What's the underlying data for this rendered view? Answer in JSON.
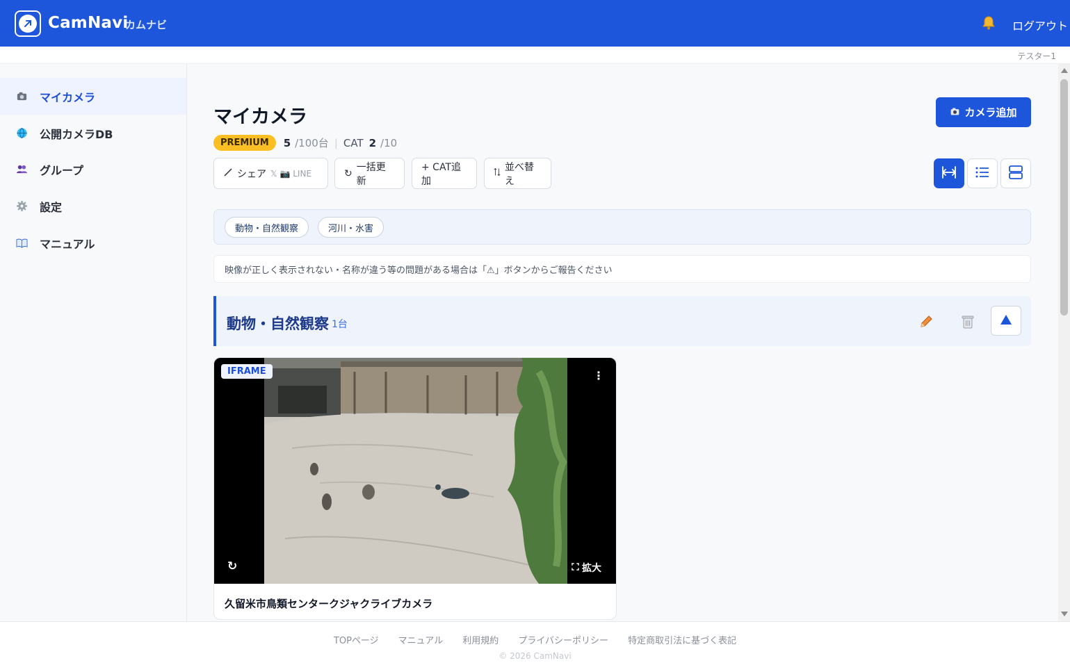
{
  "header": {
    "brand": "CamNavi",
    "brand_kana": "カムナビ",
    "logout_label": "ログアウト",
    "username": "テスター1",
    "brand_color": "#1d56db"
  },
  "sidebar": {
    "items": [
      {
        "label": "マイカメラ",
        "icon": "camera-icon",
        "active": true
      },
      {
        "label": "公開カメラDB",
        "icon": "globe-icon",
        "active": false
      },
      {
        "label": "グループ",
        "icon": "users-icon",
        "active": false
      },
      {
        "label": "設定",
        "icon": "gear-icon",
        "active": false
      },
      {
        "label": "マニュアル",
        "icon": "book-icon",
        "active": false
      }
    ]
  },
  "main": {
    "title": "マイカメラ",
    "add_camera_label": "カメラ追加",
    "plan": {
      "badge": "PREMIUM",
      "camera_count": "5",
      "camera_limit": "/100台",
      "cat_label": "CAT",
      "cat_count": "2",
      "cat_limit": "/10"
    },
    "toolbar": {
      "share_label": "シェア",
      "share_targets": "𝕏 📷 LINE",
      "refresh_all_label": "一括更新",
      "add_cat_label": "+ CAT追加",
      "sort_label": "並べ替え"
    },
    "view_modes": [
      {
        "name": "expand-view",
        "active": true
      },
      {
        "name": "list-view",
        "active": false
      },
      {
        "name": "stack-view",
        "active": false
      }
    ],
    "filter_chips": [
      "動物・自然観察",
      "河川・水害"
    ],
    "notice": "映像が正しく表示されない・名称が違う等の問題がある場合は「⚠」ボタンからご報告ください",
    "category": {
      "title": "動物・自然観察",
      "count": "1台"
    },
    "camera": {
      "badge": "IFRAME",
      "expand_label": "拡大",
      "name": "久留米市鳥類センタークジャクライブカメラ"
    }
  },
  "footer": {
    "links": [
      "TOPページ",
      "マニュアル",
      "利用規約",
      "プライバシーポリシー",
      "特定商取引法に基づく表記"
    ],
    "copyright": "© 2026 CamNavi"
  }
}
